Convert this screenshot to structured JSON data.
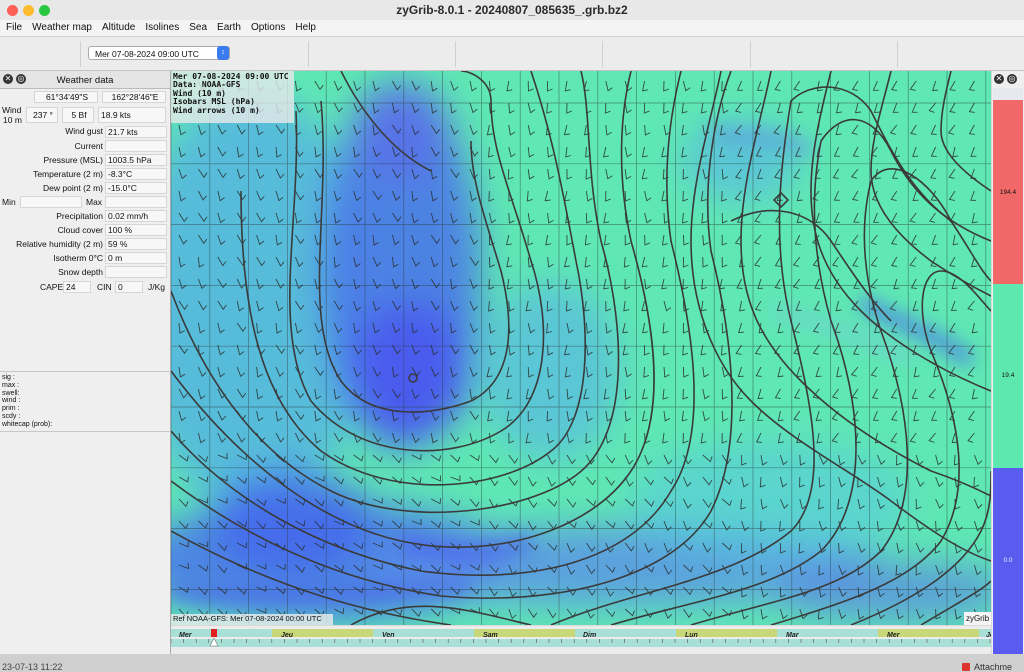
{
  "window": {
    "title": "zyGrib-8.0.1 - 20240807_085635_.grb.bz2",
    "traffic": {
      "close": "#ff5f57",
      "minimize": "#febc2e",
      "zoom": "#28c840"
    }
  },
  "menu": [
    "File",
    "Weather map",
    "Altitude",
    "Isolines",
    "Sea",
    "Earth",
    "Options",
    "Help"
  ],
  "toolbar": {
    "date_select": "Mer 07-08-2024 09:00 UTC"
  },
  "panel": {
    "title": "Weather data",
    "lat": "61°34'49\"S",
    "lon": "162°28'46\"E",
    "wind_label": "Wind",
    "wind_sub": "10 m",
    "wind_dir": "237 °",
    "wind_bf": "5 Bf",
    "wind_speed": "18.9  kts",
    "rows": [
      {
        "label": "Wind gust",
        "value": "21.7  kts"
      },
      {
        "label": "Current",
        "value": ""
      },
      {
        "label": "Pressure (MSL)",
        "value": "1003.5 hPa"
      },
      {
        "label": "Temperature (2 m)",
        "value": "-8.3°C"
      },
      {
        "label": "Dew point (2 m)",
        "value": "-15.0°C"
      },
      {
        "label": "Precipitation",
        "value": "0.02 mm/h"
      },
      {
        "label": "Cloud cover",
        "value": "100 %"
      },
      {
        "label": "Relative humidity (2 m)",
        "value": "59 %"
      },
      {
        "label": "Isotherm 0°C",
        "value": "0 m"
      },
      {
        "label": "Snow depth",
        "value": ""
      }
    ],
    "min_label": "Min",
    "max_label": "Max",
    "cape_label": "CAPE",
    "cape_value": "24",
    "cin_label": "CIN",
    "cin_value": "0",
    "cape_unit": "J/Kg",
    "extra_lines": [
      "sig  :",
      "max  :",
      "swell:",
      "wind :",
      "prim :",
      "scdy :",
      "whitecap (prob):"
    ]
  },
  "map": {
    "info_lines": [
      "Mer 07-08-2024 09:00 UTC",
      "Data: NOAA-GFS",
      "Wind (10 m)",
      "Isobars MSL (hPa)",
      "Wind arrows (10 m)"
    ],
    "ref_text": "Ref NOAA-GFS: Mer 07-08-2024 00:00 UTC",
    "brand": "zyGrib"
  },
  "timeline": {
    "days": [
      "Mer",
      "Jeu",
      "Ven",
      "Sam",
      "Dim",
      "Lun",
      "Mar",
      "Mer",
      "Je"
    ],
    "colors": {
      "band_a": "#c8d878",
      "band_b": "#a8e0d8"
    }
  },
  "scale": {
    "labels": [
      "194.4",
      "19.4",
      "0.0"
    ],
    "colors": [
      "#f06868",
      "#5de8b0",
      "#5a5cf0"
    ]
  },
  "bottom": {
    "left_text": "23-07-13 11:22",
    "right_text": "Attachme"
  }
}
